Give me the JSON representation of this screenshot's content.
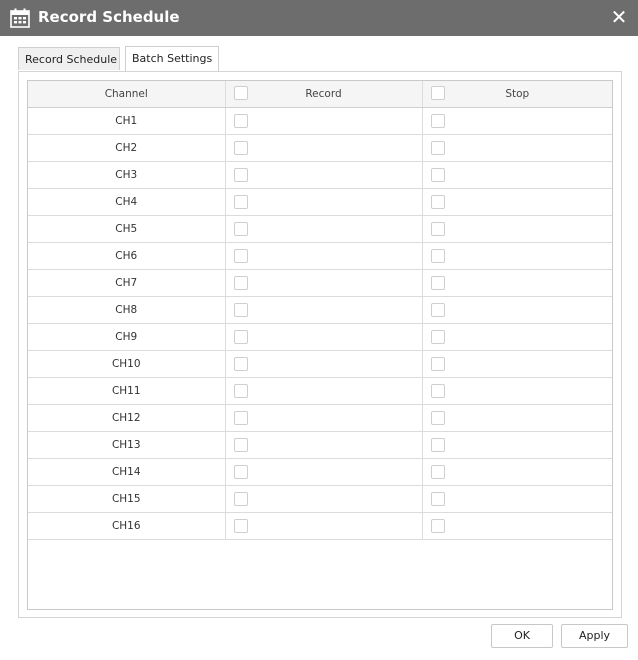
{
  "dialog": {
    "title": "Record Schedule",
    "close_glyph": "✕",
    "title_icon": "calendar-icon"
  },
  "tabs": [
    {
      "label": "Record Schedule",
      "active": false
    },
    {
      "label": "Batch Settings",
      "active": true
    }
  ],
  "table": {
    "headers": {
      "channel": "Channel",
      "record": "Record",
      "stop": "Stop"
    },
    "rows": [
      {
        "channel": "CH1"
      },
      {
        "channel": "CH2"
      },
      {
        "channel": "CH3"
      },
      {
        "channel": "CH4"
      },
      {
        "channel": "CH5"
      },
      {
        "channel": "CH6"
      },
      {
        "channel": "CH7"
      },
      {
        "channel": "CH8"
      },
      {
        "channel": "CH9"
      },
      {
        "channel": "CH10"
      },
      {
        "channel": "CH11"
      },
      {
        "channel": "CH12"
      },
      {
        "channel": "CH13"
      },
      {
        "channel": "CH14"
      },
      {
        "channel": "CH15"
      },
      {
        "channel": "CH16"
      }
    ]
  },
  "buttons": {
    "ok": "OK",
    "apply": "Apply"
  }
}
